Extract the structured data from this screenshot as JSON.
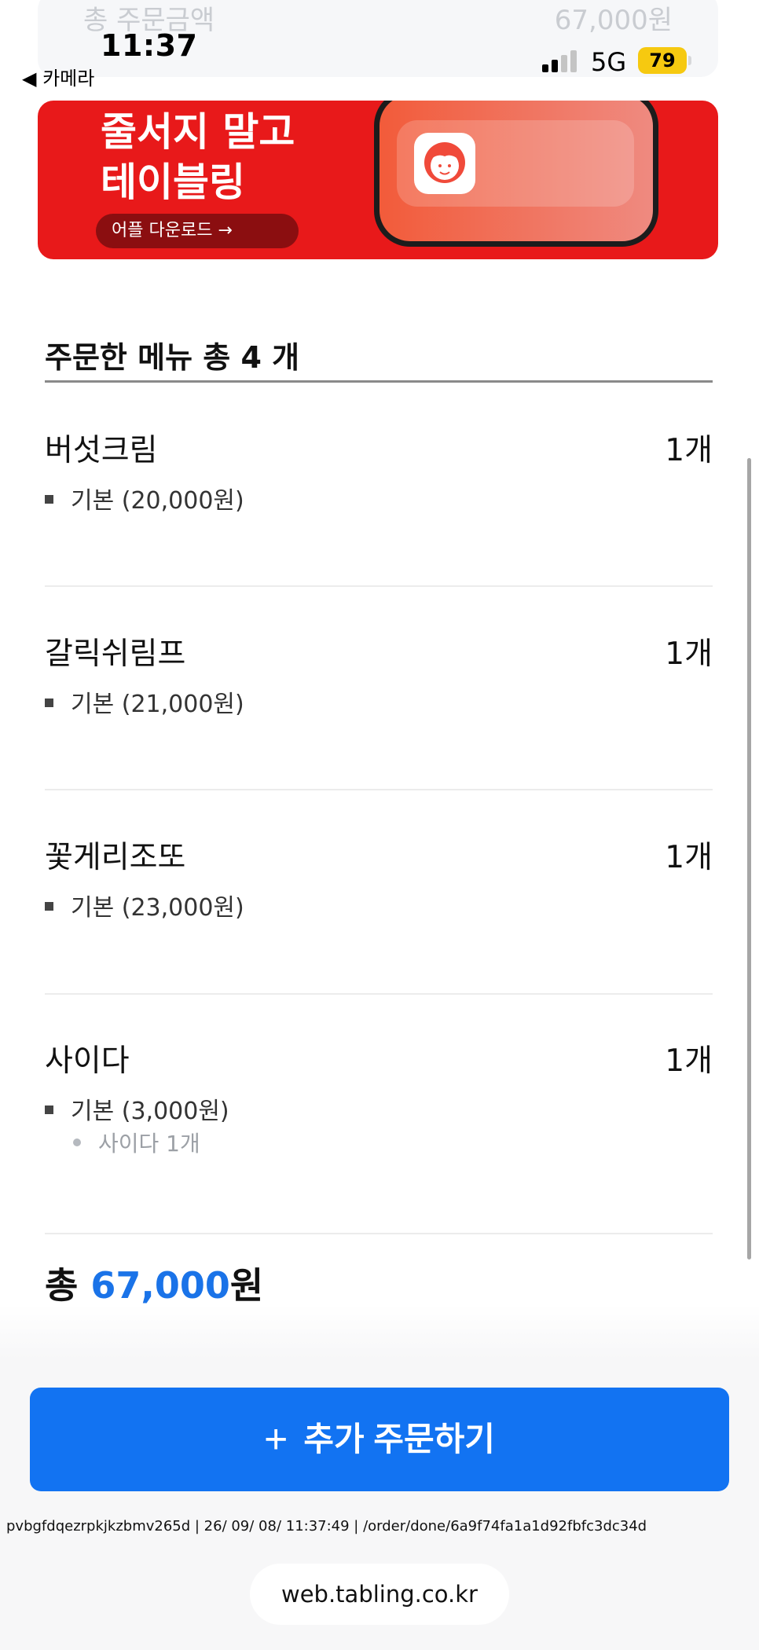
{
  "status_bar": {
    "time": "11:37",
    "back_label": "◀ 카메라",
    "network": "5G",
    "battery": "79"
  },
  "summary_peek": {
    "label": "총 주문금액",
    "amount": "67,000원"
  },
  "banner": {
    "title": "줄서지 말고\n테이블링",
    "download_button": "어플 다운로드 →",
    "bg_color": "#e8191a"
  },
  "order": {
    "heading": "주문한 메뉴 총 4 개",
    "items": [
      {
        "name": "버섯크림",
        "qty": "1개",
        "option": "기본 (20,000원)"
      },
      {
        "name": "갈릭쉬림프",
        "qty": "1개",
        "option": "기본 (21,000원)"
      },
      {
        "name": "꽃게리조또",
        "qty": "1개",
        "option": "기본 (23,000원)"
      },
      {
        "name": "사이다",
        "qty": "1개",
        "option": "기본 (3,000원)",
        "sub_option": "사이다 1개"
      }
    ],
    "total_prefix": "총",
    "total_amount": "67,000",
    "total_suffix": "원"
  },
  "actions": {
    "add_order_icon": "plus-icon",
    "add_order_label": "추가 주문하기",
    "primary_color": "#1273f2"
  },
  "debug_line": "pvbgfdqezrpkjkzbmv265d | 26/ 09/ 08/ 11:37:49 | /order/done/6a9f74fa1a1d92fbfc3dc34d",
  "browser": {
    "url": "web.tabling.co.kr"
  }
}
